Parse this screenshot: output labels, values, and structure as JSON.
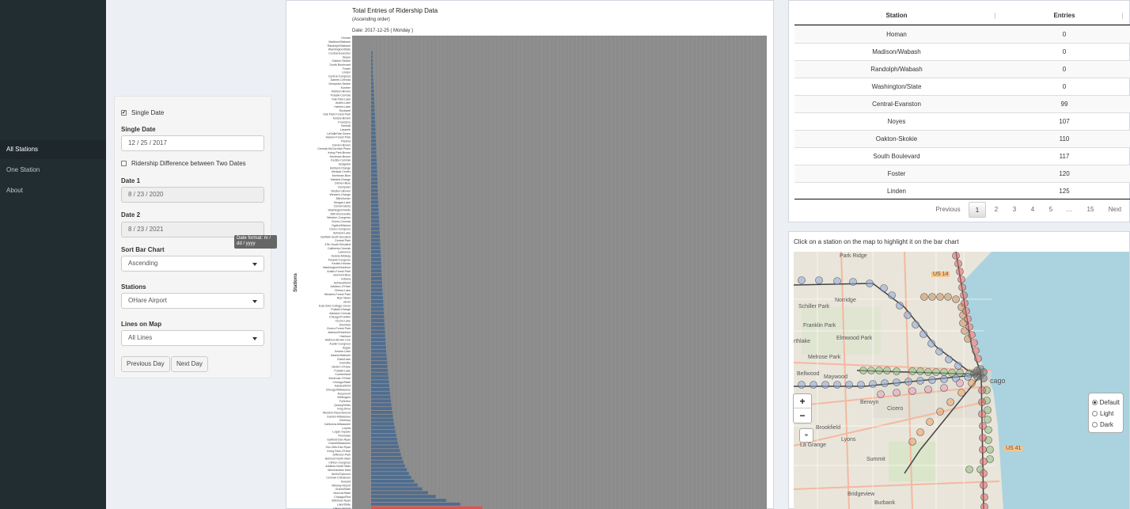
{
  "sidebar": {
    "items": [
      {
        "label": "All Stations",
        "active": true
      },
      {
        "label": "One Station",
        "active": false
      },
      {
        "label": "About",
        "active": false
      }
    ]
  },
  "controls": {
    "single_date_checkbox": {
      "label": "Single Date",
      "checked": true
    },
    "single_date": {
      "label": "Single Date",
      "value": "12 / 25 / 2017"
    },
    "difference_checkbox": {
      "label": "Ridership Difference between Two Dates",
      "checked": false
    },
    "date1": {
      "label": "Date 1",
      "value": "8 / 23 / 2020"
    },
    "date2": {
      "label": "Date 2",
      "value": "8 / 23 / 2021"
    },
    "tooltip": "Date format: m / dd / yyyy",
    "sort": {
      "label": "Sort Bar Chart",
      "value": "Ascending"
    },
    "stations": {
      "label": "Stations",
      "value": "OHare Airport"
    },
    "lines": {
      "label": "Lines on Map",
      "value": "All Lines"
    },
    "prev_button": "Previous Day",
    "next_button": "Next Day"
  },
  "chart_data": {
    "type": "bar",
    "orientation": "horizontal",
    "title": "Total Entries of Ridership Data",
    "subtitle": "(Ascending order)",
    "date_label": "Date:  2017-12-25 ( Monday )",
    "ylabel": "Stations",
    "categories": [
      "Homan",
      "Madison/Wabash",
      "Randolph/Wabash",
      "Washington/State",
      "Central-Evanston",
      "Noyes",
      "Oakton-Skokie",
      "South Boulevard",
      "Foster",
      "Linden",
      "Central-Congress",
      "Damen-Cermak",
      "Dempster-Skokie",
      "Kostner",
      "Addison-Brown",
      "Pulaski-Cermak",
      "Oak Park-Lake",
      "Austin-Lake",
      "Harlem-Lake",
      "Rockwell",
      "Oak Park-Forest Park",
      "Kedzie-Brown",
      "Francisco",
      "Kimball",
      "Laramie",
      "LaSalle/Van Buren",
      "Harlem-Forest Park",
      "Paulina",
      "Damen-Brown",
      "Cermak-McCormick Place",
      "Irving Park-Brown",
      "Montrose-Brown",
      "Kedzie-Cermak",
      "Sedgwick",
      "Ashland-Orange",
      "Medical Center",
      "Montrose-Blue",
      "Halsted-Orange",
      "Damen-Blue",
      "Dempster",
      "Western-Brown",
      "Western-Orange",
      "35th/Archer",
      "Morgan-Lake",
      "Conservatory",
      "Washington/Wells",
      "35th-Bronzeville",
      "Western-Congress",
      "Cicero-Cermak",
      "Ogden/Mission",
      "Cicero-Congress",
      "Ashland-Lake",
      "Garfield-South Elevated",
      "Central Park",
      "47th-South Elevated",
      "California-Cermak",
      "Lawrence",
      "Kedzie-Midway",
      "Pulaski-Congress",
      "Kedzie-Homan",
      "Washington/Dearborn",
      "Austin-Forest Park",
      "Belmont-Blue",
      "Indiana",
      "Ashland/63rd",
      "Addison-O'Hare",
      "Clinton-Lake",
      "Western-Forest Park",
      "Bryn Mawr",
      "Jarvis",
      "East 63rd-Cottage Grove",
      "Pulaski-Orange",
      "Ashland-Cermak",
      "Chicago/Franklin",
      "Cicero-Lake",
      "Sheridan",
      "Cicero-Forest Park",
      "Jackson/Dearborn",
      "Harrison",
      "Addison-Brown Line",
      "Austin-Congress",
      "Argyle",
      "Kedzie-Lake",
      "Adams/Wabash",
      "Clark/Lake",
      "Granville",
      "Harlem-O'Hare",
      "Pulaski-Lake",
      "Cumberland",
      "Montrose-O'Hare",
      "Chicago/State",
      "Halsted/63rd",
      "Chicago/Milwaukee",
      "Rosemont",
      "Wellington",
      "Fullerton",
      "Quincy/Wells",
      "King Drive",
      "Western-Ravenswood",
      "Damen-Milwaukee",
      "Diversey",
      "California-Milwaukee",
      "Loyola",
      "Logan Square",
      "Thorndale",
      "Garfield-Dan Ryan",
      "Grand/Milwaukee",
      "Sox-35th-Dan Ryan",
      "Irving Park-O'Hare",
      "Jefferson Park",
      "Belmont-North Main",
      "Clinton-Congress",
      "Addison-North Main",
      "Merchandise Mart",
      "North/Clybourn",
      "Cermak-Chinatown",
      "Howard",
      "Midway Airport",
      "Grand/State",
      "Monroe/State",
      "Chicago/Red",
      "95th/Dan Ryan",
      "Lake/State",
      "OHare Airport"
    ],
    "values": [
      0,
      0,
      0,
      0,
      99,
      107,
      110,
      117,
      120,
      125,
      145,
      160,
      180,
      195,
      210,
      225,
      240,
      255,
      265,
      275,
      290,
      300,
      312,
      325,
      335,
      345,
      358,
      368,
      380,
      390,
      400,
      412,
      424,
      436,
      448,
      460,
      470,
      482,
      494,
      506,
      518,
      530,
      542,
      554,
      566,
      578,
      590,
      602,
      616,
      630,
      644,
      658,
      672,
      686,
      700,
      715,
      730,
      745,
      760,
      775,
      790,
      805,
      820,
      836,
      852,
      868,
      884,
      900,
      916,
      932,
      948,
      965,
      982,
      1000,
      1018,
      1036,
      1054,
      1072,
      1090,
      1110,
      1130,
      1150,
      1172,
      1194,
      1216,
      1240,
      1264,
      1290,
      1316,
      1344,
      1372,
      1402,
      1432,
      1464,
      1496,
      1530,
      1566,
      1604,
      1644,
      1686,
      1730,
      1778,
      1828,
      1880,
      1940,
      2000,
      2070,
      2140,
      2220,
      2300,
      2400,
      2500,
      2620,
      2760,
      2920,
      3100,
      3320,
      3600,
      3950,
      4400,
      5000,
      5800,
      6900,
      8600,
      30000
    ],
    "highlighted": "OHare Airport",
    "bar_color": "#4f6d8f",
    "highlight_color": "#e8504a",
    "panel_bg": "#8c8c8c",
    "grid": true,
    "legend": "none"
  },
  "table": {
    "headers": [
      "Station",
      "Entries"
    ],
    "rows": [
      [
        "Homan",
        "0"
      ],
      [
        "Madison/Wabash",
        "0"
      ],
      [
        "Randolph/Wabash",
        "0"
      ],
      [
        "Washington/State",
        "0"
      ],
      [
        "Central-Evanston",
        "99"
      ],
      [
        "Noyes",
        "107"
      ],
      [
        "Oakton-Skokie",
        "110"
      ],
      [
        "South Boulevard",
        "117"
      ],
      [
        "Foster",
        "120"
      ],
      [
        "Linden",
        "125"
      ]
    ],
    "pagination": {
      "previous": "Previous",
      "pages": [
        "1",
        "2",
        "3",
        "4",
        "5",
        "…",
        "15"
      ],
      "next": "Next",
      "current": "1"
    }
  },
  "map": {
    "caption": "Click on a station on the map to highlight it on the bar chart",
    "zoom_in": "+",
    "zoom_out": "−",
    "reset": "⌖",
    "layers": [
      {
        "label": "Default",
        "selected": true
      },
      {
        "label": "Light",
        "selected": false
      },
      {
        "label": "Dark",
        "selected": false
      }
    ],
    "labels": [
      "Park Ridge",
      "US 14",
      "Norridge",
      "Schiller Park",
      "Franklin Park",
      "Elmwood Park",
      "rthlake",
      "Melrose Park",
      "Bellwood",
      "Maywood",
      "Berwyn",
      "Cicero",
      "Brookfield",
      "Lyons",
      "La Grange",
      "Summit",
      "US 41",
      "Bridgeview",
      "Burbank",
      "cago"
    ]
  }
}
